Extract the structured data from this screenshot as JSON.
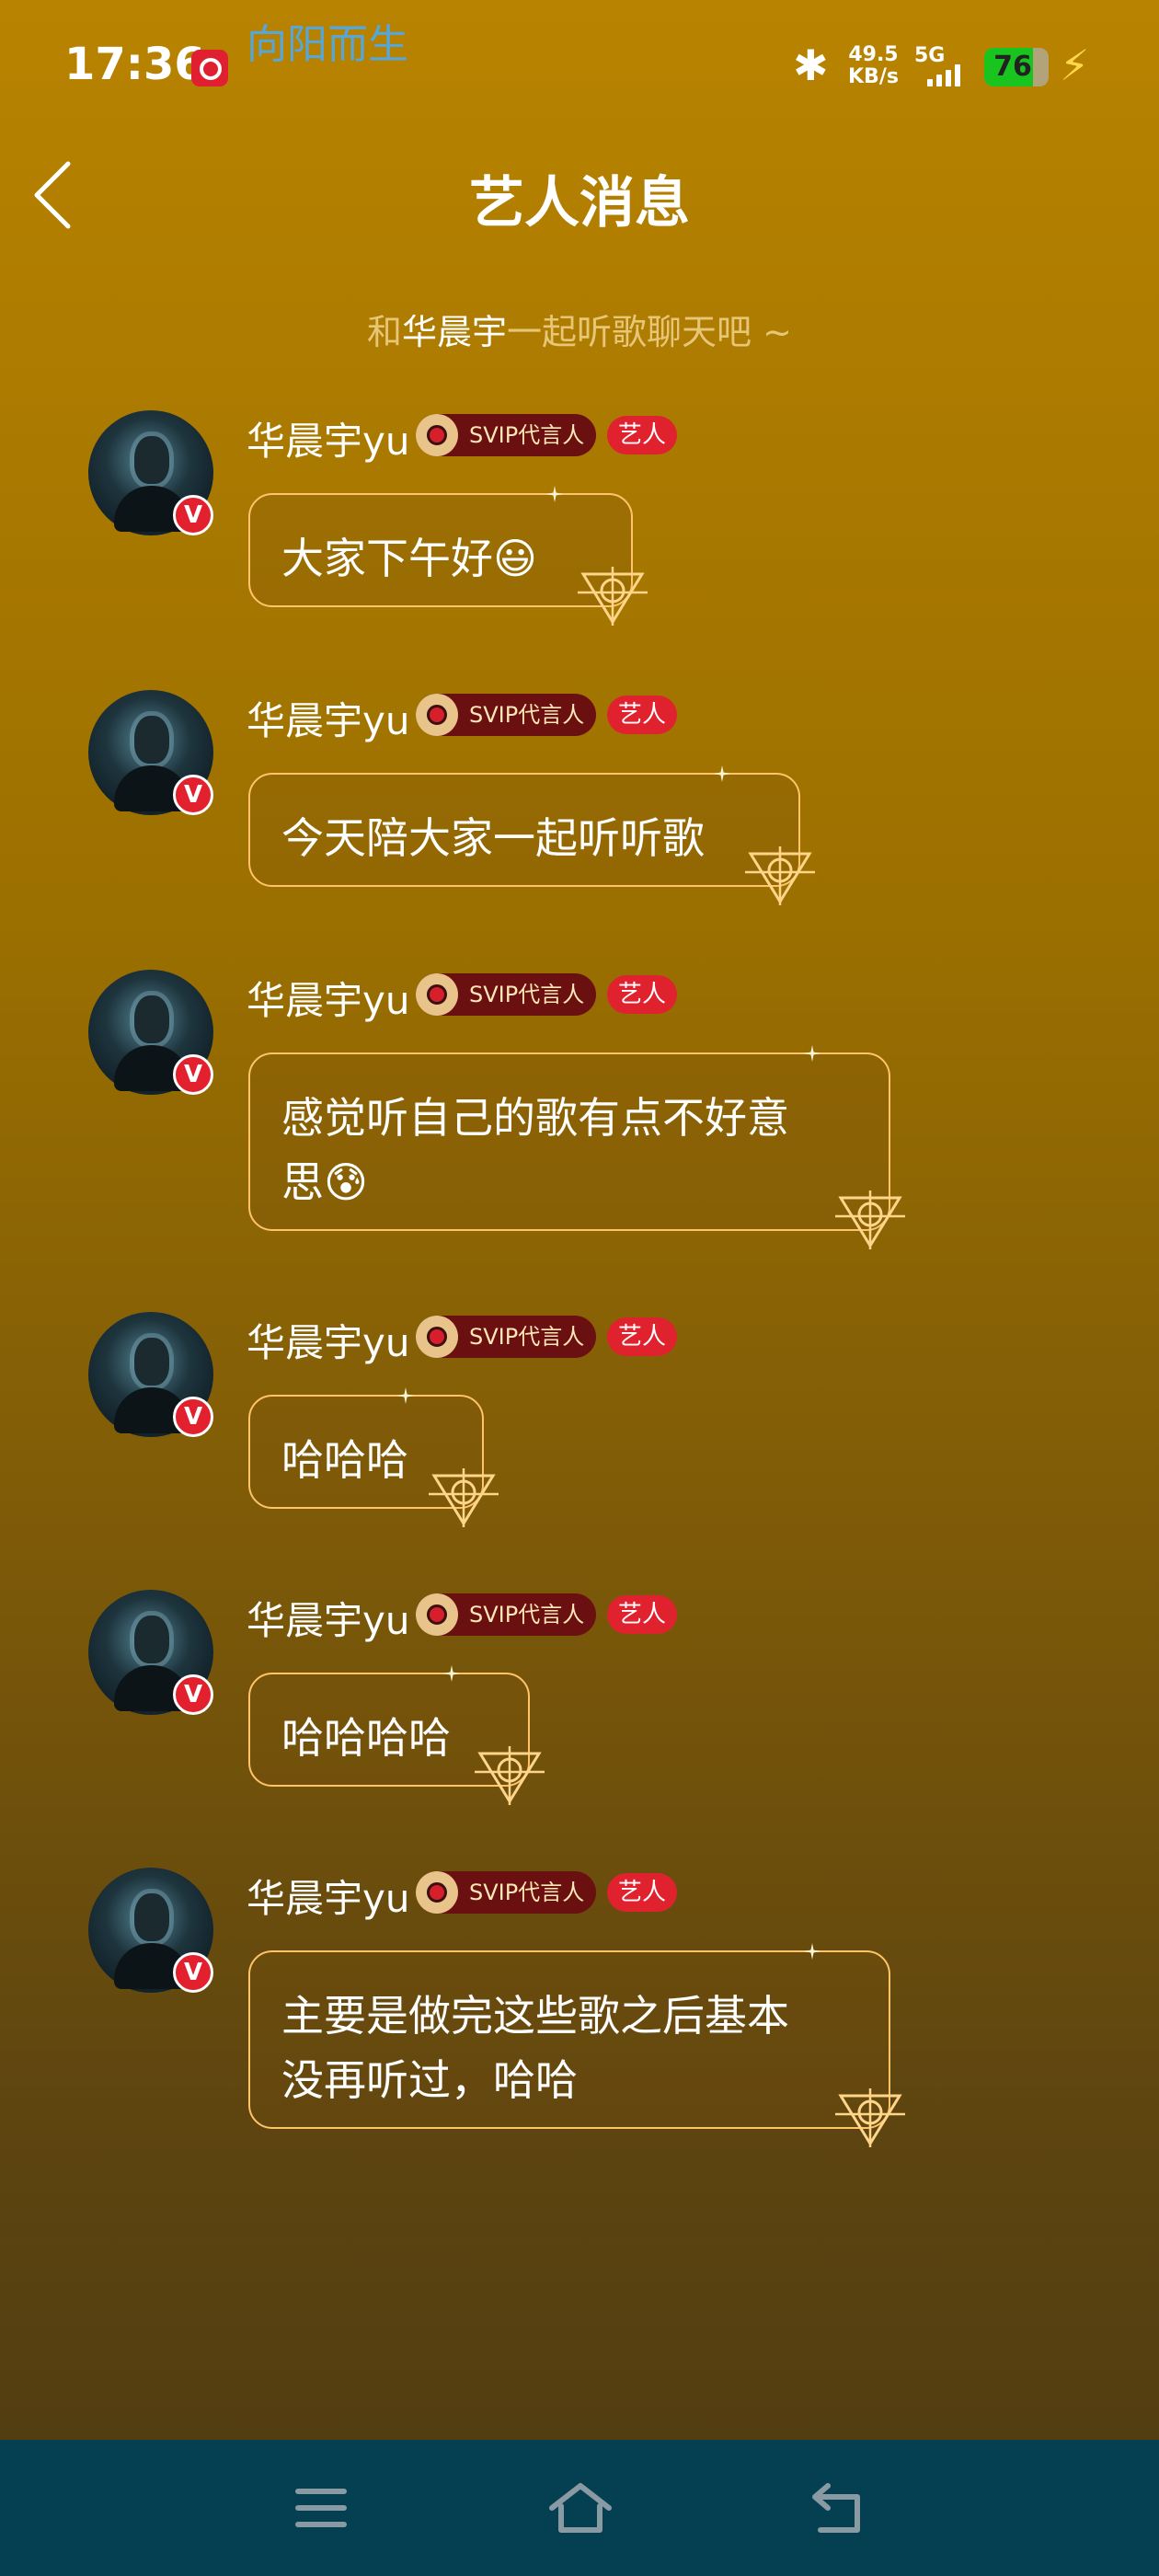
{
  "status_bar": {
    "time": "17:36",
    "now_playing": "向阳而生",
    "net_speed_value": "49.5",
    "net_speed_unit": "KB/s",
    "network_type": "5G",
    "battery": "76",
    "battery_level": 76,
    "icons": [
      "netease-music-icon",
      "bluetooth-icon",
      "signal-icon",
      "battery-icon",
      "charging-icon"
    ]
  },
  "header": {
    "title": "艺人消息",
    "back_icon": "chevron-left-icon"
  },
  "hint": {
    "prefix": "和",
    "artist": "华晨宇",
    "suffix": "一起听歌聊天吧 ~"
  },
  "messages": [
    {
      "name": "华晨宇yu",
      "badge": "SVIP代言人",
      "tag": "艺人",
      "verified": "V",
      "lines": [
        "大家下午好😃"
      ]
    },
    {
      "name": "华晨宇yu",
      "badge": "SVIP代言人",
      "tag": "艺人",
      "verified": "V",
      "lines": [
        "今天陪大家一起听听歌"
      ]
    },
    {
      "name": "华晨宇yu",
      "badge": "SVIP代言人",
      "tag": "艺人",
      "verified": "V",
      "lines": [
        "感觉听自己的歌有点不好意",
        "思😰"
      ]
    },
    {
      "name": "华晨宇yu",
      "badge": "SVIP代言人",
      "tag": "艺人",
      "verified": "V",
      "lines": [
        "哈哈哈"
      ]
    },
    {
      "name": "华晨宇yu",
      "badge": "SVIP代言人",
      "tag": "艺人",
      "verified": "V",
      "lines": [
        "哈哈哈哈"
      ]
    },
    {
      "name": "华晨宇yu",
      "badge": "SVIP代言人",
      "tag": "艺人",
      "verified": "V",
      "lines": [
        "主要是做完这些歌之后基本",
        "没再听过，哈哈"
      ]
    }
  ],
  "system_nav": {
    "icons": [
      "menu-icon",
      "home-icon",
      "back-icon"
    ]
  },
  "colors": {
    "bubble_border": "#ffc36a",
    "artist_tag": "#e0222f",
    "svip_badge": "#6a1010",
    "nav_bar": "#053f52",
    "hint_text": "#e6c88a"
  }
}
